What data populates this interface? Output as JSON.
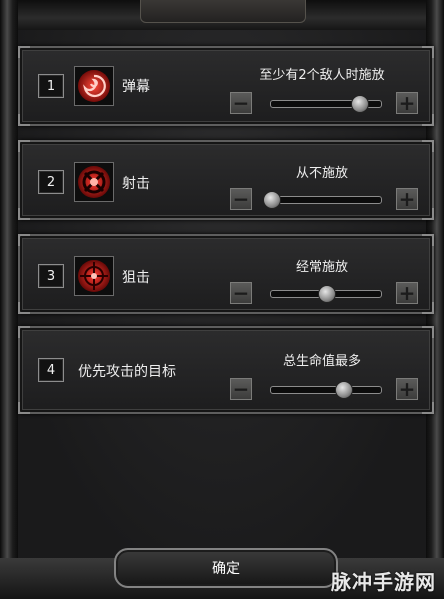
{
  "panels": [
    {
      "number": "1",
      "icon": "swirl-icon",
      "name": "弹幕",
      "status": "至少有2个敌人时施放",
      "level": 0.8
    },
    {
      "number": "2",
      "icon": "crosshair-x-icon",
      "name": "射击",
      "status": "从不施放",
      "level": 0.0
    },
    {
      "number": "3",
      "icon": "target-icon",
      "name": "狙击",
      "status": "经常施放",
      "level": 0.5
    },
    {
      "number": "4",
      "icon": null,
      "name": "优先攻击的目标",
      "status": "总生命值最多",
      "level": 0.65
    }
  ],
  "buttons": {
    "minus": "−",
    "plus": "+"
  },
  "confirm_label": "确定",
  "watermark": "脉冲手游网",
  "colors": {
    "accent_red": "#d11a1a",
    "panel_bg": "#242425",
    "text": "#eeeeee"
  }
}
